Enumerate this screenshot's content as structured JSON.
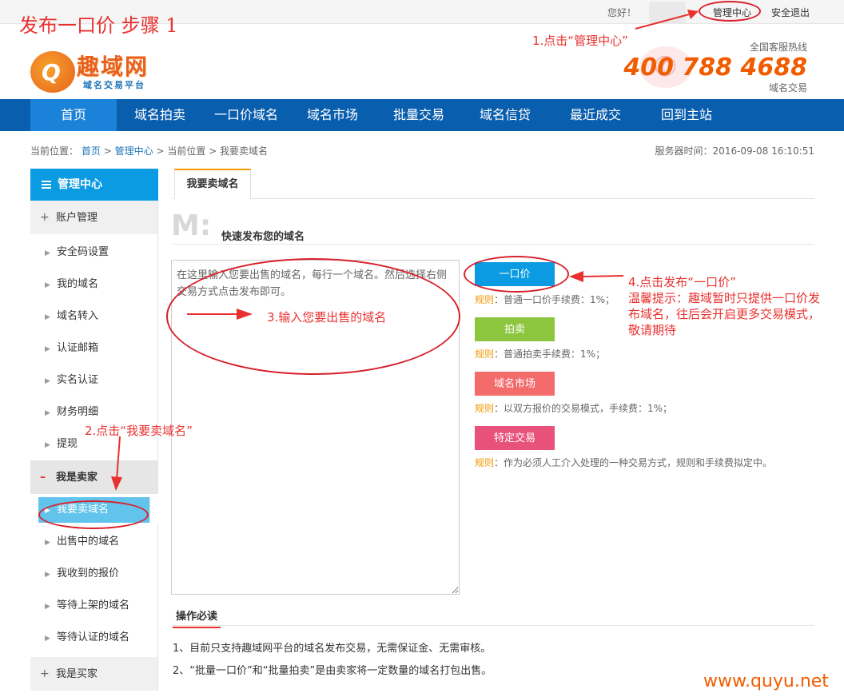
{
  "step_title": "发布一口价 步骤 1",
  "topbar": {
    "hello": "您好！",
    "manage": "管理中心",
    "logout": "安全退出"
  },
  "logo": {
    "mark": "Q",
    "name": "趣域网",
    "sub": "域名交易平台"
  },
  "hotline": {
    "label": "全国客服热线",
    "number": "400 788 4688",
    "sub": "域名交易"
  },
  "nav": [
    "首页",
    "域名拍卖",
    "一口价域名",
    "域名市场",
    "批量交易",
    "域名信贷",
    "最近成交",
    "回到主站"
  ],
  "breadcrumb": {
    "prefix": "当前位置：",
    "home": "首页",
    "sep": ">",
    "manage": "管理中心",
    "current_label": "当前位置",
    "current": "我要卖域名"
  },
  "server_time": "服务器时间：2016-09-08 16:10:51",
  "sidebar": {
    "head": "管理中心",
    "account_group": "账户管理",
    "account_items": [
      "安全码设置",
      "我的域名",
      "域名转入",
      "认证邮箱",
      "实名认证",
      "财务明细",
      "提现"
    ],
    "seller_group": "我是卖家",
    "seller_items": [
      "我要卖域名",
      "出售中的域名",
      "我收到的报价",
      "等待上架的域名",
      "等待认证的域名"
    ],
    "buyer_group": "我是买家"
  },
  "tab": "我要卖域名",
  "quick": {
    "letter": "M:",
    "title": "快速发布您的域名"
  },
  "input": {
    "placeholder": "在这里输入您要出售的域名，每行一个域名。然后选择右侧交易方式点击发布即可。"
  },
  "options": [
    {
      "label": "一口价",
      "color": "#0a9be2",
      "rule_key": "规则",
      "rule": "：普通一口价手续费：1%；"
    },
    {
      "label": "拍卖",
      "color": "#8cc63f",
      "rule_key": "规则",
      "rule": "：普通拍卖手续费：1%；"
    },
    {
      "label": "域名市场",
      "color": "#f46b6b",
      "rule_key": "规则",
      "rule": "：以双方报价的交易模式，手续费：1%；"
    },
    {
      "label": "特定交易",
      "color": "#e8527a",
      "rule_key": "规则",
      "rule": "：作为必须人工介入处理的一种交易方式，规则和手续费拟定中。"
    }
  ],
  "notice": {
    "title": "操作必读",
    "items": [
      "1、目前只支持趣域网平台的域名发布交易，无需保证金、无需审核。",
      "2、“批量一口价”和“批量拍卖”是由卖家将一定数量的域名打包出售。"
    ]
  },
  "annotations": {
    "a1": "1.点击“管理中心”",
    "a2": "2.点击“我要卖域名”",
    "a3": "3.输入您要出售的域名",
    "a4": "4.点击发布“一口价”",
    "a4_tip1": "温馨提示：趣域暂时只提供一口价发",
    "a4_tip2": "布域名，往后会开启更多交易模式，",
    "a4_tip3": "敬请期待"
  },
  "watermark": "www.quyu.net",
  "colors": {
    "nav": "#0a5eae",
    "nav_active": "#1a82d8",
    "sidebar_head": "#0a9be2",
    "annotation": "#e8312f",
    "accent": "#f39800"
  }
}
